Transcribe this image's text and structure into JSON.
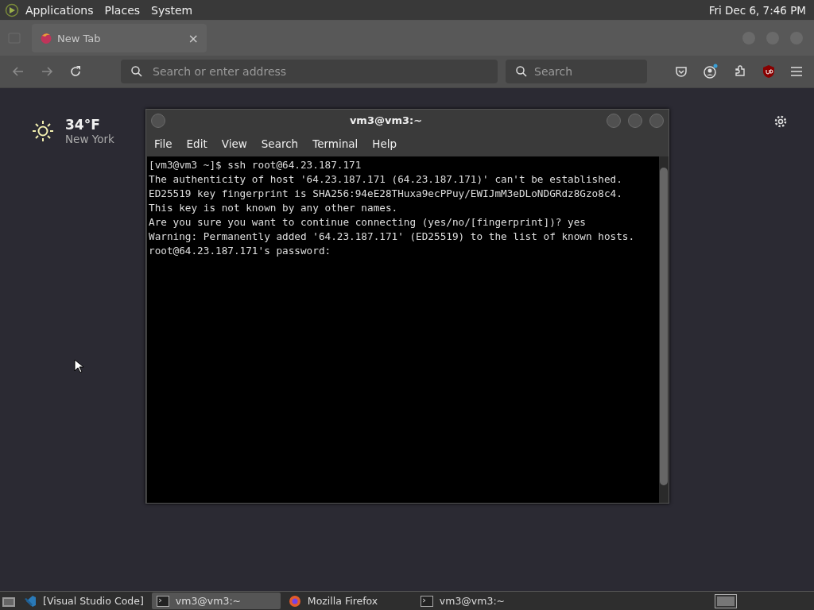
{
  "top_panel": {
    "menus": [
      "Applications",
      "Places",
      "System"
    ],
    "clock": "Fri Dec 6, 7:46 PM"
  },
  "browser": {
    "tabs": [
      {
        "label": "New Tab",
        "close": "×"
      }
    ],
    "address_bar": {
      "placeholder": "Search or enter address"
    },
    "search_bar": {
      "placeholder": "Search"
    },
    "weather": {
      "temperature": "34°F",
      "location": "New York"
    }
  },
  "terminal": {
    "title": "vm3@vm3:~",
    "menus": [
      "File",
      "Edit",
      "View",
      "Search",
      "Terminal",
      "Help"
    ],
    "lines": [
      "[vm3@vm3 ~]$ ssh root@64.23.187.171",
      "The authenticity of host '64.23.187.171 (64.23.187.171)' can't be established.",
      "ED25519 key fingerprint is SHA256:94eE28THuxa9ecPPuy/EWIJmM3eDLoNDGRdz8Gzo8c4.",
      "This key is not known by any other names.",
      "Are you sure you want to continue connecting (yes/no/[fingerprint])? yes",
      "Warning: Permanently added '64.23.187.171' (ED25519) to the list of known hosts.",
      "root@64.23.187.171's password:"
    ]
  },
  "taskbar": {
    "items": [
      {
        "label": "[Visual Studio Code]",
        "kind": "code",
        "selected": false
      },
      {
        "label": "vm3@vm3:~",
        "kind": "terminal",
        "selected": true
      },
      {
        "label": "Mozilla Firefox",
        "kind": "firefox",
        "selected": false
      },
      {
        "label": "vm3@vm3:~",
        "kind": "terminal",
        "selected": false
      }
    ]
  }
}
